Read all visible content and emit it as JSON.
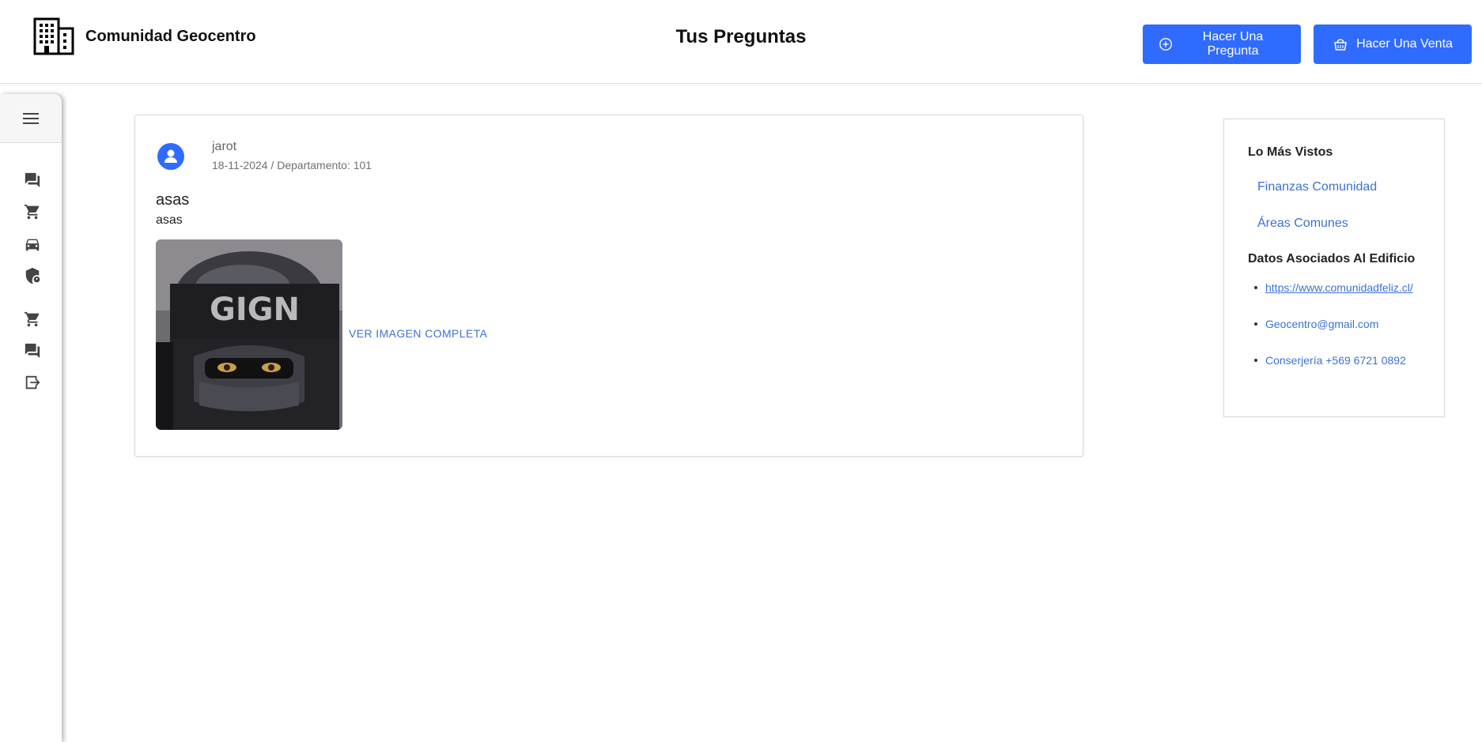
{
  "header": {
    "brand_name": "Comunidad Geocentro",
    "page_title": "Tus Preguntas",
    "ask_button": "Hacer Una Pregunta",
    "sell_button": "Hacer Una Venta"
  },
  "sidebar": {
    "icons": [
      "menu-icon",
      "forum-icon",
      "cart-icon",
      "car-icon",
      "shield-icon",
      "cart-icon",
      "forum-icon",
      "logout-icon"
    ]
  },
  "post": {
    "author": "jarot",
    "meta": "18-11-2024 / Departamento: 101",
    "title": "asas",
    "body": "asas",
    "image_text": "GIGN",
    "view_link": "VER IMAGEN COMPLETA"
  },
  "panel": {
    "most_viewed_heading": "Lo Más Vistos",
    "most_viewed": [
      "Finanzas Comunidad",
      "Áreas Comunes"
    ],
    "building_heading": "Datos Asociados Al Edificio",
    "website": "https://www.comunidadfeliz.cl/",
    "email": "Geocentro@gmail.com",
    "phone": "Conserjería +569 6721 0892"
  },
  "colors": {
    "primary": "#2f6bff",
    "link": "#3d70d6"
  }
}
